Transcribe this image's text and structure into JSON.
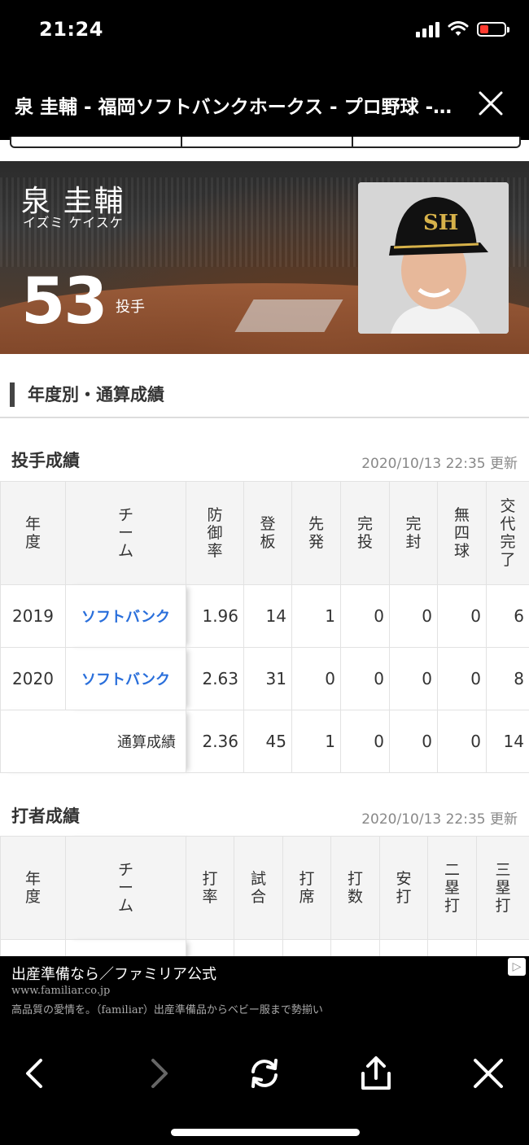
{
  "status_bar": {
    "time": "21:24"
  },
  "browser": {
    "title": "泉 圭輔 - 福岡ソフトバンクホークス - プロ野球 - スポーツナビ"
  },
  "player": {
    "name": "泉 圭輔",
    "kana": "イズミ ケイスケ",
    "number": "53",
    "position": "投手"
  },
  "section_title": "年度別・通算成績",
  "pitching": {
    "heading": "投手成績",
    "updated": "2020/10/13 22:35 更新",
    "headers": [
      "年度",
      "チーム",
      "防御率",
      "登板",
      "先発",
      "完投",
      "完封",
      "無四球",
      "交代完了"
    ],
    "rows": [
      {
        "year": "2019",
        "team": "ソフトバンク",
        "era": "1.96",
        "games": "14",
        "starts": "1",
        "cg": "0",
        "sho": "0",
        "nowalk": "0",
        "gf": "6"
      },
      {
        "year": "2020",
        "team": "ソフトバンク",
        "era": "2.63",
        "games": "31",
        "starts": "0",
        "cg": "0",
        "sho": "0",
        "nowalk": "0",
        "gf": "8"
      }
    ],
    "total": {
      "label": "通算成績",
      "era": "2.36",
      "games": "45",
      "starts": "1",
      "cg": "0",
      "sho": "0",
      "nowalk": "0",
      "gf": "14"
    }
  },
  "batting": {
    "heading": "打者成績",
    "updated": "2020/10/13 22:35 更新",
    "headers": [
      "年度",
      "チーム",
      "打率",
      "試合",
      "打席",
      "打数",
      "安打",
      "二塁打",
      "三塁打"
    ]
  },
  "ad": {
    "title": "出産準備なら／ファミリア公式",
    "url": "www.familiar.co.jp",
    "description": "高品質の愛情を。（familiar）出産準備品からベビー服まで勢揃い"
  },
  "icons": {
    "close": "close-icon",
    "back": "chevron-left-icon",
    "forward": "chevron-right-icon",
    "reload": "reload-icon",
    "share": "share-icon",
    "ad_choices": "ad-choices-icon"
  }
}
